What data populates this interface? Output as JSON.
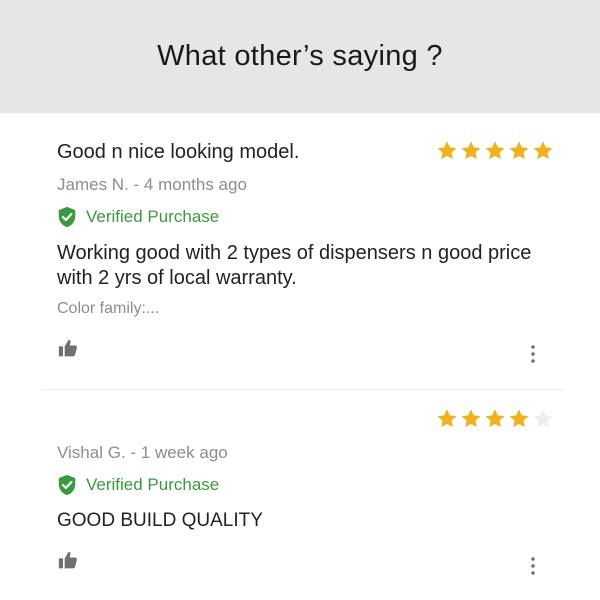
{
  "header": {
    "title": "What other’s saying ?"
  },
  "colors": {
    "star_filled": "#f2b01e",
    "star_empty": "#eeeeee",
    "verified_green": "#3a9a3f",
    "header_bg": "#e5e6e7"
  },
  "reviews": [
    {
      "title": "Good n nice looking model.",
      "rating": 5,
      "max_rating": 5,
      "reviewer": "James N. - 4  months ago",
      "verified_label": "Verified Purchase",
      "body": "Working good with 2 types of dispensers n good price with 2 yrs of local warranty.",
      "variant": "Color family:...",
      "like_icon": "thumbs-up-icon",
      "menu_icon": "more-vertical-icon"
    },
    {
      "title": "",
      "rating": 4,
      "max_rating": 5,
      "reviewer": "Vishal G. - 1  week ago",
      "verified_label": "Verified Purchase",
      "body": "GOOD BUILD QUALITY",
      "like_icon": "thumbs-up-icon",
      "menu_icon": "more-vertical-icon"
    }
  ]
}
